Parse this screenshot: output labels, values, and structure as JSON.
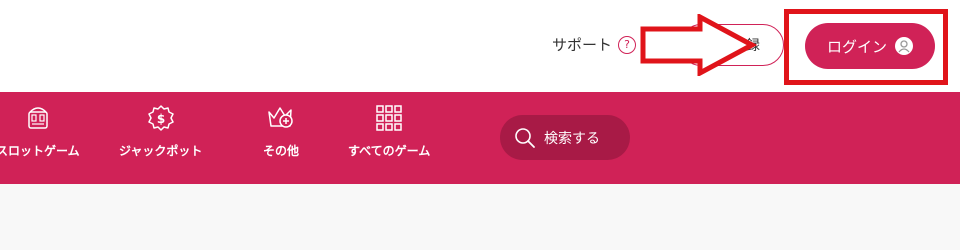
{
  "header": {
    "support_label": "サポート",
    "help_icon": "question-circle-icon",
    "register_label": "新規登録",
    "login_label": "ログイン",
    "login_icon": "user-avatar-icon"
  },
  "nav": {
    "items": [
      {
        "label": "スロットゲーム",
        "icon": "slot-machine-icon"
      },
      {
        "label": "ジャックポット",
        "icon": "dollar-badge-icon"
      },
      {
        "label": "その他",
        "icon": "crown-plus-icon"
      },
      {
        "label": "すべてのゲーム",
        "icon": "grid-icon"
      }
    ],
    "search_label": "検索する",
    "search_icon": "search-icon"
  },
  "annotation": {
    "arrow": "red-arrow-icon",
    "highlight": "red-highlight-box"
  },
  "colors": {
    "brand": "#d02257",
    "search_bg": "#a81a46",
    "annotation_red": "#e0141a"
  }
}
